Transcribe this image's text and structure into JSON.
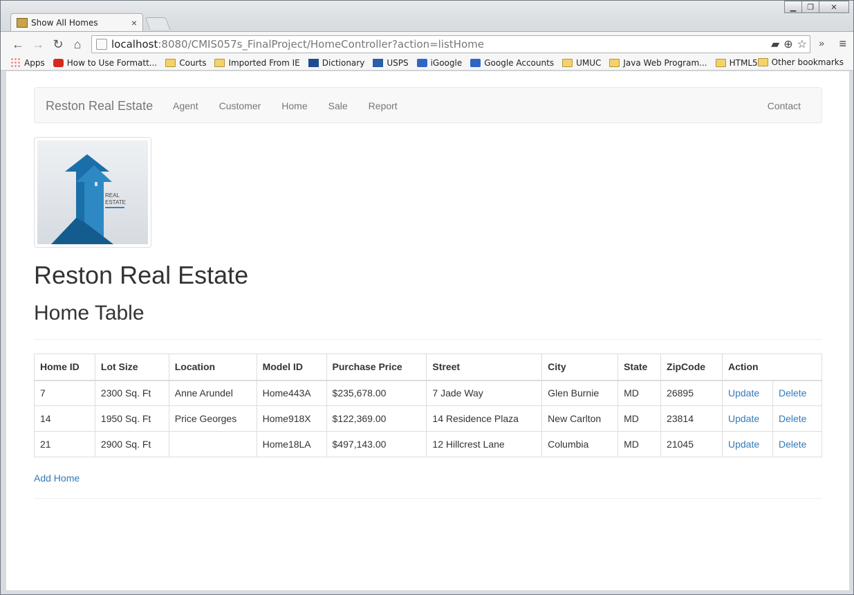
{
  "browser": {
    "tab_title": "Show All Homes",
    "tab_close": "×",
    "url_host": "localhost",
    "url_rest": ":8080/CMIS057s_FinalProject/HomeController?action=listHome",
    "bookmarks": [
      {
        "label": "Apps",
        "icon": "apps-icon"
      },
      {
        "label": "How to Use Formatt...",
        "icon": "red-icon"
      },
      {
        "label": "Courts",
        "icon": "folder-icon"
      },
      {
        "label": "Imported From IE",
        "icon": "folder-icon"
      },
      {
        "label": "Dictionary",
        "icon": "dictionary-icon"
      },
      {
        "label": "USPS",
        "icon": "usps-icon"
      },
      {
        "label": "iGoogle",
        "icon": "google-icon"
      },
      {
        "label": "Google Accounts",
        "icon": "google-icon"
      },
      {
        "label": "UMUC",
        "icon": "folder-icon"
      },
      {
        "label": "Java Web Program...",
        "icon": "folder-icon"
      },
      {
        "label": "HTML5",
        "icon": "folder-icon"
      }
    ],
    "other_bookmarks": "Other bookmarks"
  },
  "navbar": {
    "brand": "Reston Real Estate",
    "links": [
      "Agent",
      "Customer",
      "Home",
      "Sale",
      "Report"
    ],
    "contact": "Contact"
  },
  "logo": {
    "text_line1": "REAL",
    "text_line2": "ESTATE"
  },
  "page": {
    "heading": "Reston Real Estate",
    "subheading": "Home Table",
    "add_link": "Add Home"
  },
  "table": {
    "headers": [
      "Home ID",
      "Lot Size",
      "Location",
      "Model ID",
      "Purchase Price",
      "Street",
      "City",
      "State",
      "ZipCode",
      "Action"
    ],
    "rows": [
      {
        "id": "7",
        "lot": "2300 Sq. Ft",
        "location": "Anne Arundel",
        "model": "Home443A",
        "price": "$235,678.00",
        "street": "7 Jade Way",
        "city": "Glen Burnie",
        "state": "MD",
        "zip": "26895",
        "update": "Update",
        "delete": "Delete"
      },
      {
        "id": "14",
        "lot": "1950 Sq. Ft",
        "location": "Price Georges",
        "model": "Home918X",
        "price": "$122,369.00",
        "street": "14 Residence Plaza",
        "city": "New Carlton",
        "state": "MD",
        "zip": "23814",
        "update": "Update",
        "delete": "Delete"
      },
      {
        "id": "21",
        "lot": "2900 Sq. Ft",
        "location": "",
        "model": "Home18LA",
        "price": "$497,143.00",
        "street": "12 Hillcrest Lane",
        "city": "Columbia",
        "state": "MD",
        "zip": "21045",
        "update": "Update",
        "delete": "Delete"
      }
    ]
  }
}
